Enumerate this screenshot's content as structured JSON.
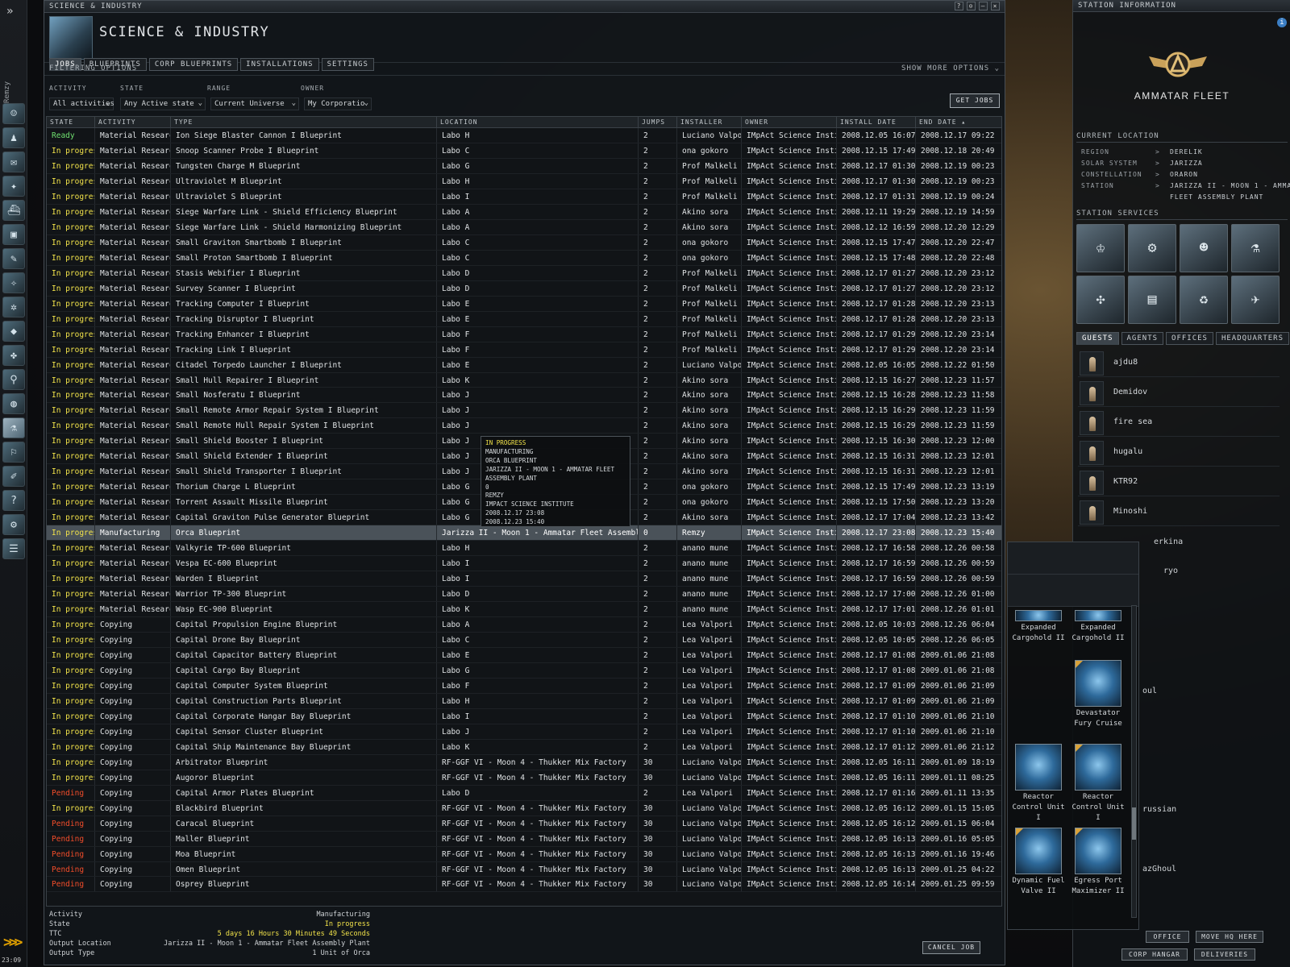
{
  "neocom": {
    "pilot_name": "Remzy",
    "clock": "23:09",
    "expand_glyph": "»",
    "collapse_glyph": ">>>"
  },
  "window": {
    "title_small": "SCIENCE & INDUSTRY",
    "title_big": "SCIENCE & INDUSTRY",
    "controls": [
      "?",
      "⊙",
      "–",
      "×"
    ],
    "tabs": [
      "JOBS",
      "BLUEPRINTS",
      "CORP BLUEPRINTS",
      "INSTALLATIONS",
      "SETTINGS"
    ],
    "filter_label": "FILTERING OPTIONS",
    "show_more": "SHOW MORE OPTIONS",
    "filters": {
      "activity_label": "ACTIVITY",
      "activity_value": "All activities",
      "state_label": "STATE",
      "state_value": "Any Active state",
      "range_label": "RANGE",
      "range_value": "Current Universe",
      "owner_label": "OWNER",
      "owner_value": "My Corporatio"
    },
    "get_jobs": "GET JOBS",
    "columns": [
      "STATE",
      "ACTIVITY",
      "TYPE",
      "LOCATION",
      "JUMPS",
      "INSTALLER",
      "OWNER",
      "INSTALL DATE",
      "END DATE"
    ],
    "rows": [
      [
        "Ready",
        "Material Research",
        "Ion Siege Blaster Cannon I Blueprint",
        "Labo H",
        "2",
        "Luciano Valpori",
        "IMpAct Science Institute",
        "2008.12.05 16:07",
        "2008.12.17 09:22"
      ],
      [
        "In progress",
        "Material Research",
        "Snoop Scanner Probe I Blueprint",
        "Labo C",
        "2",
        "ona gokoro",
        "IMpAct Science Institute",
        "2008.12.15 17:49",
        "2008.12.18 20:49"
      ],
      [
        "In progress",
        "Material Research",
        "Tungsten Charge M Blueprint",
        "Labo G",
        "2",
        "Prof Malkeli",
        "IMpAct Science Institute",
        "2008.12.17 01:30",
        "2008.12.19 00:23"
      ],
      [
        "In progress",
        "Material Research",
        "Ultraviolet M Blueprint",
        "Labo H",
        "2",
        "Prof Malkeli",
        "IMpAct Science Institute",
        "2008.12.17 01:30",
        "2008.12.19 00:23"
      ],
      [
        "In progress",
        "Material Research",
        "Ultraviolet S Blueprint",
        "Labo I",
        "2",
        "Prof Malkeli",
        "IMpAct Science Institute",
        "2008.12.17 01:31",
        "2008.12.19 00:24"
      ],
      [
        "In progress",
        "Material Research",
        "Siege Warfare Link - Shield Efficiency Blueprint",
        "Labo A",
        "2",
        "Akino sora",
        "IMpAct Science Institute",
        "2008.12.11 19:29",
        "2008.12.19 14:59"
      ],
      [
        "In progress",
        "Material Research",
        "Siege Warfare Link - Shield Harmonizing Blueprint",
        "Labo A",
        "2",
        "Akino sora",
        "IMpAct Science Institute",
        "2008.12.12 16:59",
        "2008.12.20 12:29"
      ],
      [
        "In progress",
        "Material Research",
        "Small Graviton Smartbomb I Blueprint",
        "Labo C",
        "2",
        "ona gokoro",
        "IMpAct Science Institute",
        "2008.12.15 17:47",
        "2008.12.20 22:47"
      ],
      [
        "In progress",
        "Material Research",
        "Small Proton Smartbomb I Blueprint",
        "Labo C",
        "2",
        "ona gokoro",
        "IMpAct Science Institute",
        "2008.12.15 17:48",
        "2008.12.20 22:48"
      ],
      [
        "In progress",
        "Material Research",
        "Stasis Webifier I Blueprint",
        "Labo D",
        "2",
        "Prof Malkeli",
        "IMpAct Science Institute",
        "2008.12.17 01:27",
        "2008.12.20 23:12"
      ],
      [
        "In progress",
        "Material Research",
        "Survey Scanner I Blueprint",
        "Labo D",
        "2",
        "Prof Malkeli",
        "IMpAct Science Institute",
        "2008.12.17 01:27",
        "2008.12.20 23:12"
      ],
      [
        "In progress",
        "Material Research",
        "Tracking Computer I Blueprint",
        "Labo E",
        "2",
        "Prof Malkeli",
        "IMpAct Science Institute",
        "2008.12.17 01:28",
        "2008.12.20 23:13"
      ],
      [
        "In progress",
        "Material Research",
        "Tracking Disruptor I Blueprint",
        "Labo E",
        "2",
        "Prof Malkeli",
        "IMpAct Science Institute",
        "2008.12.17 01:28",
        "2008.12.20 23:13"
      ],
      [
        "In progress",
        "Material Research",
        "Tracking Enhancer I Blueprint",
        "Labo F",
        "2",
        "Prof Malkeli",
        "IMpAct Science Institute",
        "2008.12.17 01:29",
        "2008.12.20 23:14"
      ],
      [
        "In progress",
        "Material Research",
        "Tracking Link I Blueprint",
        "Labo F",
        "2",
        "Prof Malkeli",
        "IMpAct Science Institute",
        "2008.12.17 01:29",
        "2008.12.20 23:14"
      ],
      [
        "In progress",
        "Material Research",
        "Citadel Torpedo Launcher I Blueprint",
        "Labo E",
        "2",
        "Luciano Valpori",
        "IMpAct Science Institute",
        "2008.12.05 16:05",
        "2008.12.22 01:50"
      ],
      [
        "In progress",
        "Material Research",
        "Small Hull Repairer I Blueprint",
        "Labo K",
        "2",
        "Akino sora",
        "IMpAct Science Institute",
        "2008.12.15 16:27",
        "2008.12.23 11:57"
      ],
      [
        "In progress",
        "Material Research",
        "Small Nosferatu I Blueprint",
        "Labo J",
        "2",
        "Akino sora",
        "IMpAct Science Institute",
        "2008.12.15 16:28",
        "2008.12.23 11:58"
      ],
      [
        "In progress",
        "Material Research",
        "Small Remote Armor Repair System I Blueprint",
        "Labo J",
        "2",
        "Akino sora",
        "IMpAct Science Institute",
        "2008.12.15 16:29",
        "2008.12.23 11:59"
      ],
      [
        "In progress",
        "Material Research",
        "Small Remote Hull Repair System I Blueprint",
        "Labo J",
        "2",
        "Akino sora",
        "IMpAct Science Institute",
        "2008.12.15 16:29",
        "2008.12.23 11:59"
      ],
      [
        "In progress",
        "Material Research",
        "Small Shield Booster I Blueprint",
        "Labo J",
        "2",
        "Akino sora",
        "IMpAct Science Institute",
        "2008.12.15 16:30",
        "2008.12.23 12:00"
      ],
      [
        "In progress",
        "Material Research",
        "Small Shield Extender I Blueprint",
        "Labo J",
        "2",
        "Akino sora",
        "IMpAct Science Institute",
        "2008.12.15 16:31",
        "2008.12.23 12:01"
      ],
      [
        "In progress",
        "Material Research",
        "Small Shield Transporter I Blueprint",
        "Labo J",
        "2",
        "Akino sora",
        "IMpAct Science Institute",
        "2008.12.15 16:31",
        "2008.12.23 12:01"
      ],
      [
        "In progress",
        "Material Research",
        "Thorium Charge L Blueprint",
        "Labo G",
        "2",
        "ona gokoro",
        "IMpAct Science Institute",
        "2008.12.15 17:49",
        "2008.12.23 13:19"
      ],
      [
        "In progress",
        "Material Research",
        "Torrent Assault Missile Blueprint",
        "Labo G",
        "2",
        "ona gokoro",
        "IMpAct Science Institute",
        "2008.12.15 17:50",
        "2008.12.23 13:20"
      ],
      [
        "In progress",
        "Material Research",
        "Capital Graviton Pulse Generator Blueprint",
        "Labo G",
        "2",
        "Akino sora",
        "IMpAct Science Institute",
        "2008.12.17 17:04",
        "2008.12.23 13:42"
      ],
      [
        "In progress",
        "Manufacturing",
        "Orca Blueprint",
        "Jarizza II - Moon 1 - Ammatar Fleet Assembly Plant",
        "0",
        "Remzy",
        "IMpAct Science Institute",
        "2008.12.17 23:08",
        "2008.12.23 15:40"
      ],
      [
        "In progress",
        "Material Research",
        "Valkyrie TP-600 Blueprint",
        "Labo H",
        "2",
        "anano mune",
        "IMpAct Science Institute",
        "2008.12.17 16:58",
        "2008.12.26 00:58"
      ],
      [
        "In progress",
        "Material Research",
        "Vespa EC-600 Blueprint",
        "Labo I",
        "2",
        "anano mune",
        "IMpAct Science Institute",
        "2008.12.17 16:59",
        "2008.12.26 00:59"
      ],
      [
        "In progress",
        "Material Research",
        "Warden I Blueprint",
        "Labo I",
        "2",
        "anano mune",
        "IMpAct Science Institute",
        "2008.12.17 16:59",
        "2008.12.26 00:59"
      ],
      [
        "In progress",
        "Material Research",
        "Warrior TP-300 Blueprint",
        "Labo D",
        "2",
        "anano mune",
        "IMpAct Science Institute",
        "2008.12.17 17:00",
        "2008.12.26 01:00"
      ],
      [
        "In progress",
        "Material Research",
        "Wasp EC-900 Blueprint",
        "Labo K",
        "2",
        "anano mune",
        "IMpAct Science Institute",
        "2008.12.17 17:01",
        "2008.12.26 01:01"
      ],
      [
        "In progress",
        "Copying",
        "Capital Propulsion Engine Blueprint",
        "Labo A",
        "2",
        "Lea Valpori",
        "IMpAct Science Institute",
        "2008.12.05 10:03",
        "2008.12.26 06:04"
      ],
      [
        "In progress",
        "Copying",
        "Capital Drone Bay Blueprint",
        "Labo C",
        "2",
        "Lea Valpori",
        "IMpAct Science Institute",
        "2008.12.05 10:05",
        "2008.12.26 06:05"
      ],
      [
        "In progress",
        "Copying",
        "Capital Capacitor Battery Blueprint",
        "Labo E",
        "2",
        "Lea Valpori",
        "IMpAct Science Institute",
        "2008.12.17 01:08",
        "2009.01.06 21:08"
      ],
      [
        "In progress",
        "Copying",
        "Capital Cargo Bay Blueprint",
        "Labo G",
        "2",
        "Lea Valpori",
        "IMpAct Science Institute",
        "2008.12.17 01:08",
        "2009.01.06 21:08"
      ],
      [
        "In progress",
        "Copying",
        "Capital Computer System Blueprint",
        "Labo F",
        "2",
        "Lea Valpori",
        "IMpAct Science Institute",
        "2008.12.17 01:09",
        "2009.01.06 21:09"
      ],
      [
        "In progress",
        "Copying",
        "Capital Construction Parts Blueprint",
        "Labo H",
        "2",
        "Lea Valpori",
        "IMpAct Science Institute",
        "2008.12.17 01:09",
        "2009.01.06 21:09"
      ],
      [
        "In progress",
        "Copying",
        "Capital Corporate Hangar Bay Blueprint",
        "Labo I",
        "2",
        "Lea Valpori",
        "IMpAct Science Institute",
        "2008.12.17 01:10",
        "2009.01.06 21:10"
      ],
      [
        "In progress",
        "Copying",
        "Capital Sensor Cluster Blueprint",
        "Labo J",
        "2",
        "Lea Valpori",
        "IMpAct Science Institute",
        "2008.12.17 01:10",
        "2009.01.06 21:10"
      ],
      [
        "In progress",
        "Copying",
        "Capital Ship Maintenance Bay Blueprint",
        "Labo K",
        "2",
        "Lea Valpori",
        "IMpAct Science Institute",
        "2008.12.17 01:12",
        "2009.01.06 21:12"
      ],
      [
        "In progress",
        "Copying",
        "Arbitrator Blueprint",
        "RF-GGF VI - Moon 4 - Thukker Mix Factory",
        "30",
        "Luciano Valpori",
        "IMpAct Science Institute",
        "2008.12.05 16:11",
        "2009.01.09 18:19"
      ],
      [
        "In progress",
        "Copying",
        "Augoror Blueprint",
        "RF-GGF VI - Moon 4 - Thukker Mix Factory",
        "30",
        "Luciano Valpori",
        "IMpAct Science Institute",
        "2008.12.05 16:11",
        "2009.01.11 08:25"
      ],
      [
        "Pending",
        "Copying",
        "Capital Armor Plates Blueprint",
        "Labo D",
        "2",
        "Lea Valpori",
        "IMpAct Science Institute",
        "2008.12.17 01:16",
        "2009.01.11 13:35"
      ],
      [
        "In progress",
        "Copying",
        "Blackbird Blueprint",
        "RF-GGF VI - Moon 4 - Thukker Mix Factory",
        "30",
        "Luciano Valpori",
        "IMpAct Science Institute",
        "2008.12.05 16:12",
        "2009.01.15 15:05"
      ],
      [
        "Pending",
        "Copying",
        "Caracal Blueprint",
        "RF-GGF VI - Moon 4 - Thukker Mix Factory",
        "30",
        "Luciano Valpori",
        "IMpAct Science Institute",
        "2008.12.05 16:12",
        "2009.01.15 06:04"
      ],
      [
        "Pending",
        "Copying",
        "Maller Blueprint",
        "RF-GGF VI - Moon 4 - Thukker Mix Factory",
        "30",
        "Luciano Valpori",
        "IMpAct Science Institute",
        "2008.12.05 16:13",
        "2009.01.16 05:05"
      ],
      [
        "Pending",
        "Copying",
        "Moa Blueprint",
        "RF-GGF VI - Moon 4 - Thukker Mix Factory",
        "30",
        "Luciano Valpori",
        "IMpAct Science Institute",
        "2008.12.05 16:13",
        "2009.01.16 19:46"
      ],
      [
        "Pending",
        "Copying",
        "Omen Blueprint",
        "RF-GGF VI - Moon 4 - Thukker Mix Factory",
        "30",
        "Luciano Valpori",
        "IMpAct Science Institute",
        "2008.12.05 16:13",
        "2009.01.25 04:22"
      ],
      [
        "Pending",
        "Copying",
        "Osprey Blueprint",
        "RF-GGF VI - Moon 4 - Thukker Mix Factory",
        "30",
        "Luciano Valpori",
        "IMpAct Science Institute",
        "2008.12.05 16:14",
        "2009.01.25 09:59"
      ]
    ],
    "tooltip": [
      "IN PROGRESS",
      "MANUFACTURING",
      "ORCA BLUEPRINT",
      "JARIZZA II - MOON 1 - AMMATAR FLEET",
      "ASSEMBLY PLANT",
      "0",
      "REMZY",
      "IMPACT SCIENCE INSTITUTE",
      "2008.12.17 23:08",
      "2008.12.23 15:40"
    ],
    "details": {
      "activity_label": "Activity",
      "activity": "Manufacturing",
      "state_label": "State",
      "state": "In progress",
      "ttc_label": "TTC",
      "ttc": "5 days 16 Hours 30 Minutes 49 Seconds",
      "output_location_label": "Output Location",
      "output_location": "Jarizza II - Moon 1 - Ammatar Fleet Assembly Plant",
      "output_type_label": "Output Type",
      "output_type": "1 Unit of Orca"
    },
    "cancel_job": "CANCEL JOB"
  },
  "hangar": {
    "items": [
      {
        "name": "Expanded Cargohold II"
      },
      {
        "name": "Expanded Cargohold II"
      },
      {
        "name": "Devastator Fury Cruise"
      },
      {
        "name": "Reactor Control Unit I"
      },
      {
        "name": "Reactor Control Unit I"
      },
      {
        "name": "Dynamic Fuel Valve II"
      },
      {
        "name": "Egress Port Maximizer II"
      }
    ]
  },
  "station": {
    "title": "STATION INFORMATION",
    "info_glyph": "i",
    "corp": "AMMATAR FLEET",
    "current_location": "CURRENT LOCATION",
    "region_label": "REGION",
    "region": "DERELIK",
    "system_label": "SOLAR SYSTEM",
    "system": "JARIZZA",
    "constellation_label": "CONSTELLATION",
    "constellation": "ORARON",
    "station_label": "STATION",
    "station_line1": "JARIZZA II - MOON 1 - AMMATAR",
    "station_line2": "FLEET ASSEMBLY PLANT",
    "arrow": ">",
    "services_label": "STATION SERVICES",
    "tabs": [
      "GUESTS",
      "AGENTS",
      "OFFICES",
      "HEADQUARTERS"
    ],
    "guests": [
      "ajdu8",
      "Demidov",
      "fire sea",
      "hugalu",
      "KTR92",
      "Minoshi"
    ],
    "partial_guests": [
      "erkina",
      "ryo",
      "oul",
      "russian",
      "azGhoul"
    ],
    "buttons": {
      "office": "OFFICE",
      "move_hq": "MOVE HQ HERE",
      "corp_hangar": "CORP HANGAR",
      "deliveries": "DELIVERIES"
    },
    "colors": {
      "ready": "#6fe06f",
      "in_progress": "#f2e34a",
      "pending": "#f24d2a"
    }
  }
}
